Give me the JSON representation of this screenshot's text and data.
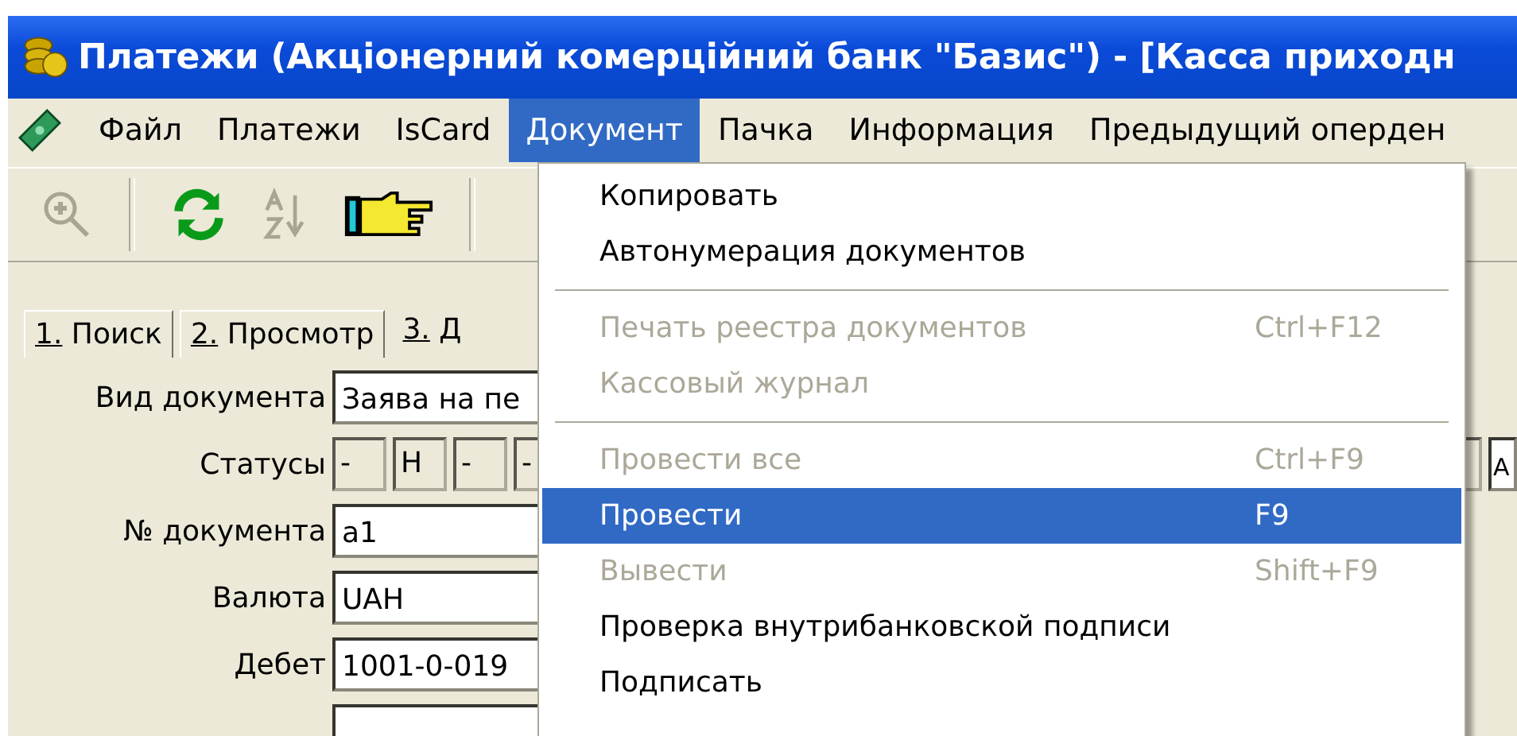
{
  "window": {
    "title": "Платежи (Акціонерний комерційний банк \"Базис\") - [Касса приходн"
  },
  "menu_bar": [
    {
      "label": "Файл",
      "selected": false
    },
    {
      "label": "Платежи",
      "selected": false
    },
    {
      "label": "IsCard",
      "selected": false
    },
    {
      "label": "Документ",
      "selected": true
    },
    {
      "label": "Пачка",
      "selected": false
    },
    {
      "label": "Информация",
      "selected": false
    },
    {
      "label": "Предыдущий оперден",
      "selected": false
    }
  ],
  "toolbar": [
    {
      "kind": "zoom",
      "disabled": true
    },
    {
      "kind": "separator"
    },
    {
      "kind": "refresh",
      "disabled": false
    },
    {
      "kind": "sort",
      "disabled": true
    },
    {
      "kind": "pointer",
      "disabled": false
    },
    {
      "kind": "separator"
    }
  ],
  "tabs": [
    {
      "label": "1. Поиск",
      "selected": false
    },
    {
      "label": "2. Просмотр",
      "selected": false
    },
    {
      "label": "3. Д",
      "selected": true
    }
  ],
  "form": [
    {
      "kind": "text",
      "label": "Вид документа",
      "value": "Заява на пе"
    },
    {
      "kind": "statuses",
      "label": "Статусы",
      "values": [
        "-",
        "Н",
        "-",
        "-"
      ],
      "extra_value": "A"
    },
    {
      "kind": "text",
      "label": "№ документа",
      "value": "a1"
    },
    {
      "kind": "text",
      "label": "Валюта",
      "value": "UAH"
    },
    {
      "kind": "text",
      "label": "Дебет",
      "value": "1001-0-019"
    }
  ],
  "dropdown": [
    {
      "kind": "item",
      "label": "Копировать",
      "disabled": false,
      "selected": false
    },
    {
      "kind": "item",
      "label": "Автонумерация документов",
      "disabled": false,
      "selected": false
    },
    {
      "kind": "separator"
    },
    {
      "kind": "item",
      "label": "Печать реестра документов",
      "shortcut": "Ctrl+F12",
      "disabled": true,
      "selected": false
    },
    {
      "kind": "item",
      "label": "Кассовый журнал",
      "disabled": true,
      "selected": false
    },
    {
      "kind": "separator"
    },
    {
      "kind": "item",
      "label": "Провести все",
      "shortcut": "Ctrl+F9",
      "disabled": true,
      "selected": false
    },
    {
      "kind": "item",
      "label": "Провести",
      "shortcut": "F9",
      "disabled": false,
      "selected": true
    },
    {
      "kind": "item",
      "label": "Вывести",
      "shortcut": "Shift+F9",
      "disabled": true,
      "selected": false
    },
    {
      "kind": "item",
      "label": "Проверка внутрибанковской подписи",
      "disabled": false,
      "selected": false
    },
    {
      "kind": "item",
      "label": "Подписать",
      "disabled": false,
      "selected": false
    }
  ]
}
